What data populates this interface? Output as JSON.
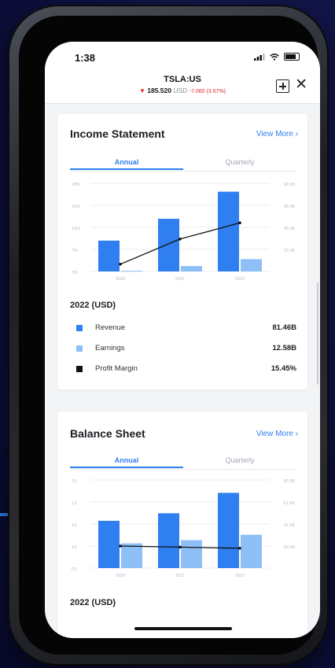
{
  "status_bar": {
    "time": "1:38",
    "icons": [
      "signal-icon",
      "wifi-icon",
      "battery-icon"
    ]
  },
  "header": {
    "ticker": "TSLA:US",
    "price": "185.520",
    "currency": "USD",
    "change": "-7.060 (3.67%)",
    "direction_icon": "down-triangle-icon",
    "colors": {
      "down": "#e0262e"
    }
  },
  "income_statement": {
    "title": "Income Statement",
    "view_more": "View More",
    "tabs": [
      "Annual",
      "Quarterly"
    ],
    "active_tab": "Annual",
    "year_label": "2022 (USD)",
    "legend": [
      {
        "name": "Revenue",
        "value": "81.46B",
        "color": "#2f7ff0"
      },
      {
        "name": "Earnings",
        "value": "12.58B",
        "color": "#8ec0f7"
      },
      {
        "name": "Profit Margin",
        "value": "15.45%",
        "color": "#111111"
      }
    ],
    "chart_data": {
      "type": "bar",
      "categories": [
        "2020",
        "2021",
        "2022"
      ],
      "series": [
        {
          "name": "Revenue",
          "values": [
            31.5,
            53.8,
            81.46
          ],
          "axis": "right"
        },
        {
          "name": "Earnings",
          "values": [
            0.7,
            5.5,
            12.58
          ],
          "axis": "right"
        },
        {
          "name": "Profit Margin",
          "values": [
            2.3,
            10.3,
            15.45
          ],
          "axis": "left",
          "type": "line"
        }
      ],
      "left_ticks": [
        "28%",
        "21%",
        "14%",
        "7%",
        "0%"
      ],
      "right_ticks": [
        "90.0B",
        "68.0B",
        "45.0B",
        "22.0B",
        ""
      ],
      "ylim_left": [
        0,
        28
      ],
      "ylim_right": [
        0,
        90
      ],
      "colors": [
        "#2f7ff0",
        "#8ec0f7",
        "#111111"
      ]
    }
  },
  "balance_sheet": {
    "title": "Balance Sheet",
    "view_more": "View More",
    "tabs": [
      "Annual",
      "Quarterly"
    ],
    "active_tab": "Annual",
    "year_label": "2022 (USD)",
    "chart_data": {
      "type": "bar",
      "categories": [
        "2020",
        "2021",
        "2022"
      ],
      "series": [
        {
          "values": [
            44,
            51,
            70
          ],
          "axis": "right"
        },
        {
          "values": [
            23,
            26,
            31
          ],
          "axis": "right"
        },
        {
          "values": [
            1.0,
            0.95,
            0.9
          ],
          "axis": "left",
          "type": "line"
        }
      ],
      "left_ticks": [
        "2X",
        "1X",
        "1X",
        "1X",
        "0X"
      ],
      "right_ticks": [
        "82.0B",
        "61.0B",
        "41.0B",
        "20.0B",
        ""
      ],
      "ylim_left": [
        0,
        4
      ],
      "ylim_right": [
        0,
        82
      ],
      "colors": [
        "#2f7ff0",
        "#8ec0f7",
        "#111111"
      ]
    }
  }
}
